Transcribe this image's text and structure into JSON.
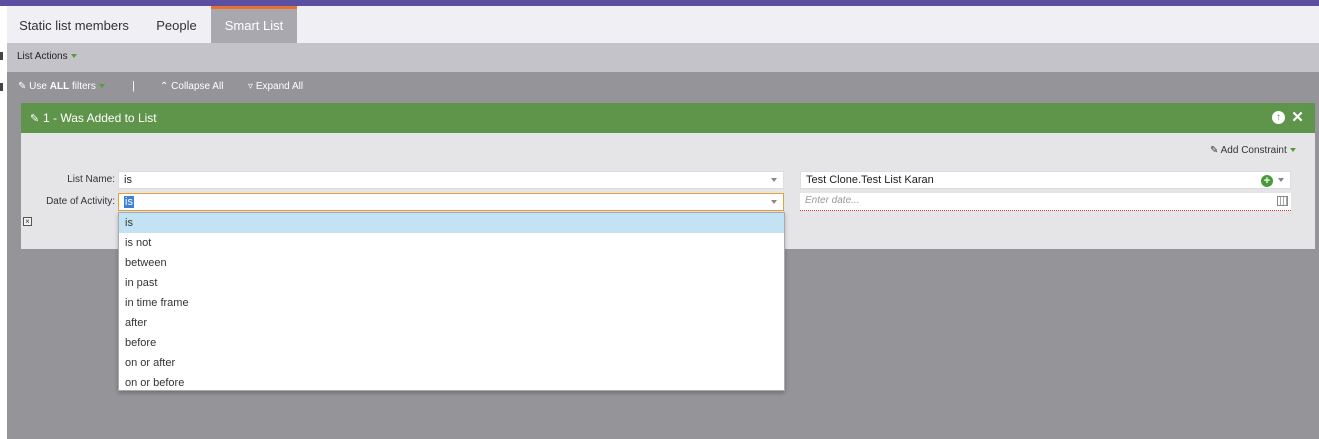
{
  "tabs": [
    {
      "label": "Static list members"
    },
    {
      "label": "People"
    },
    {
      "label": "Smart List"
    }
  ],
  "actions": {
    "list_actions": "List Actions"
  },
  "filterbar": {
    "use_prefix": "Use",
    "use_bold": "ALL",
    "use_suffix": "filters",
    "separator": "|",
    "collapse_all": "Collapse All",
    "expand_all": "Expand All"
  },
  "filter": {
    "title": "1 - Was Added to List",
    "add_constraint": "Add Constraint",
    "rows": [
      {
        "label": "List Name:",
        "operator": "is",
        "value": "Test Clone.Test List Karan"
      },
      {
        "label": "Date of Activity:",
        "operator": "is",
        "value_placeholder": "Enter date..."
      }
    ]
  },
  "dropdown": {
    "options": [
      "is",
      "is not",
      "between",
      "in past",
      "in time frame",
      "after",
      "before",
      "on or after",
      "on or before"
    ],
    "highlighted": "is"
  },
  "colors": {
    "accent_bar": "#5a4fa0",
    "active_tab_border": "#e8712e",
    "filter_header": "#5f944b",
    "highlight": "#c3e3f4"
  }
}
